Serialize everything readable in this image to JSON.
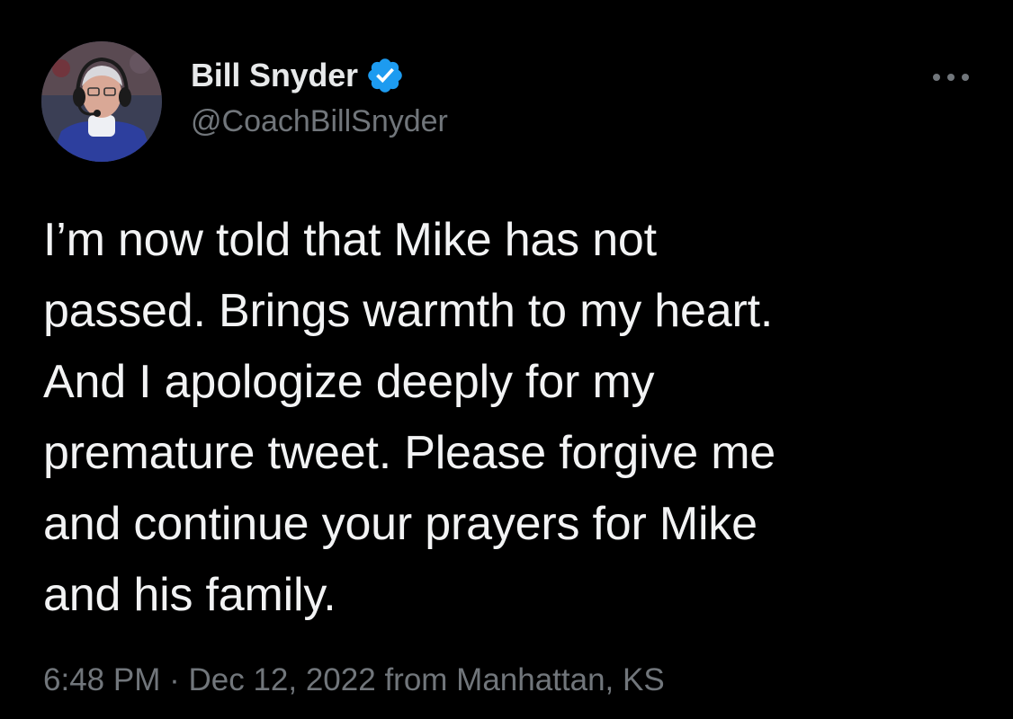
{
  "tweet": {
    "author": {
      "display_name": "Bill Snyder",
      "handle": "@CoachBillSnyder",
      "verified": true,
      "avatar_icon": "coach-headset-avatar",
      "verified_color": "#1d9bf0"
    },
    "more_icon": "more-horizontal-icon",
    "text": "I’m now told that Mike has not\npassed. Brings warmth to my heart.\nAnd I apologize deeply for my\npremature tweet. Please forgive me\nand continue your prayers for Mike\nand his family.",
    "meta": {
      "time": "6:48 PM",
      "separator": "·",
      "date": "Dec 12, 2022",
      "source": "from Manhattan, KS"
    }
  },
  "colors": {
    "background": "#000000",
    "primary_text": "#e7e9ea",
    "secondary_text": "#71767b",
    "accent": "#1d9bf0"
  }
}
